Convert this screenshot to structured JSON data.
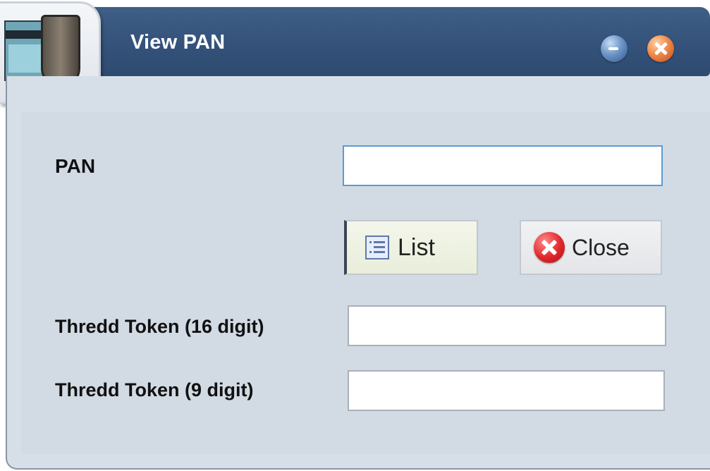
{
  "window": {
    "title": "View PAN",
    "minimize_icon": "minimize-icon",
    "close_icon": "window-close-icon",
    "app_icon": "card-shield-icon"
  },
  "form": {
    "pan_label": "PAN",
    "pan_value": "",
    "token16_label": "Thredd Token (16 digit)",
    "token16_value": "",
    "token9_label": "Thredd Token (9 digit)",
    "token9_value": ""
  },
  "buttons": {
    "list_label": "List",
    "list_icon": "list-icon",
    "close_label": "Close",
    "close_icon": "close-x-icon"
  },
  "colors": {
    "titlebar": "#34527a",
    "panel": "#d6dfe8",
    "focus_border": "#5a9bd6"
  }
}
